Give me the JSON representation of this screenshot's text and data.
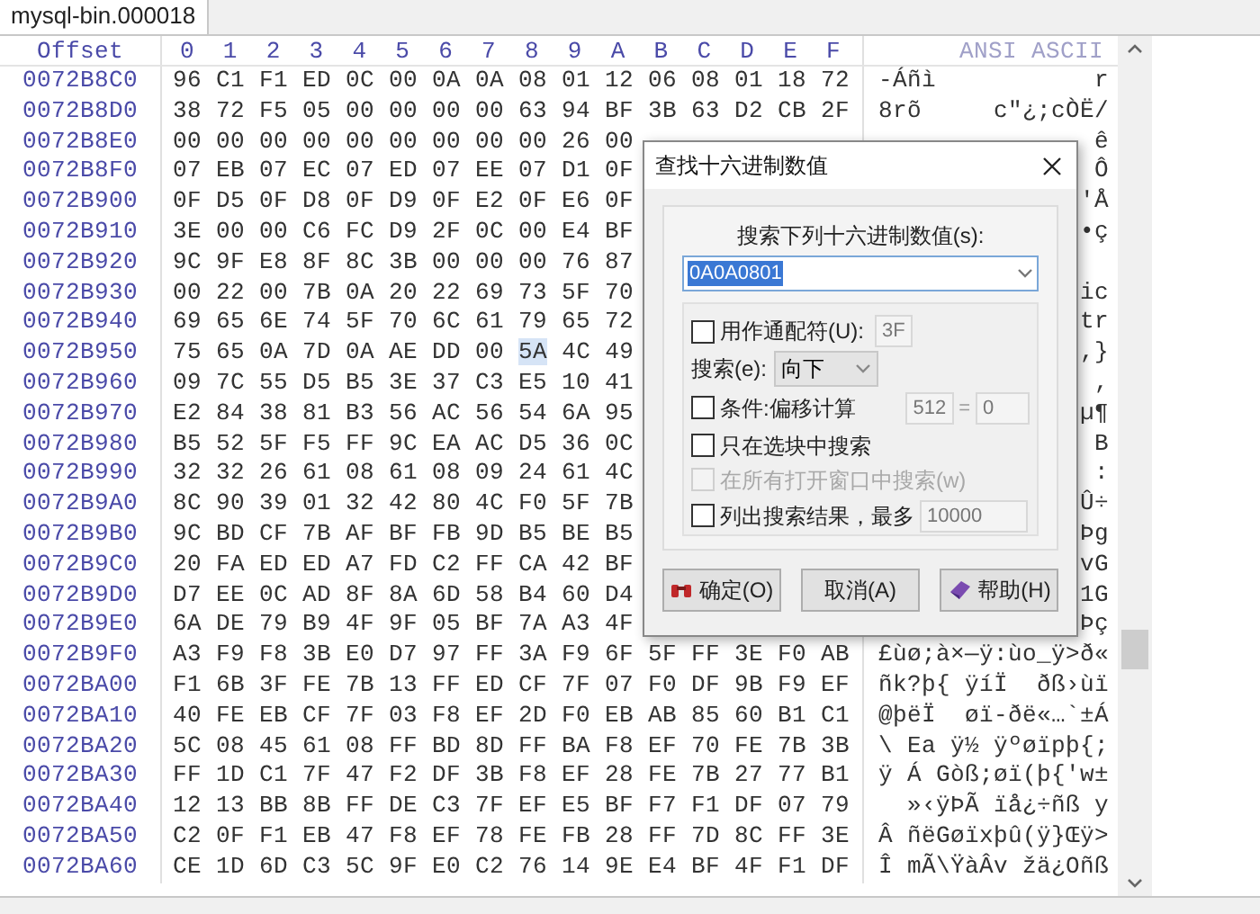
{
  "tab": {
    "label": "mysql-bin.000018",
    "selected": true
  },
  "hex_view": {
    "offset_header": "Offset",
    "column_headers": [
      "0",
      "1",
      "2",
      "3",
      "4",
      "5",
      "6",
      "7",
      "8",
      "9",
      "A",
      "B",
      "C",
      "D",
      "E",
      "F"
    ],
    "ascii_header": "ANSI ASCII",
    "rows": [
      {
        "kind": "full",
        "offset": "0072B8C0",
        "bytes": [
          {
            "text": "96 C1 F1 ED 0C 00 0A 0A 08 01 12 06 08 01 18 72",
            "selected": false
          }
        ],
        "ascii": "-Áñì           r"
      },
      {
        "kind": "full",
        "offset": "0072B8D0",
        "bytes": [
          {
            "text": "38 72 F5 05 00 00 00 00 63 94 BF 3B 63 D2 CB 2F",
            "selected": false
          }
        ],
        "ascii": "8rõ     c\"¿;cÒË/"
      },
      {
        "kind": "partial",
        "offset": "0072B8E0",
        "bytes": [
          {
            "text": "00 00 00 00 00 00 00 00 00 26 00",
            "selected": false
          }
        ],
        "ascii": "ê"
      },
      {
        "kind": "partial",
        "offset": "0072B8F0",
        "bytes": [
          {
            "text": "07 EB 07 EC 07 ED 07 EE 07 D1 0F",
            "selected": false
          }
        ],
        "ascii": "Ô"
      },
      {
        "kind": "partial",
        "offset": "0072B900",
        "bytes": [
          {
            "text": "0F D5 0F D8 0F D9 0F E2 0F E6 0F",
            "selected": false
          }
        ],
        "ascii": "'Å"
      },
      {
        "kind": "partial",
        "offset": "0072B910",
        "bytes": [
          {
            "text": "3E 00 00 C6 FC D9 2F 0C 00 E4 BF",
            "selected": false
          }
        ],
        "ascii": "•ç"
      },
      {
        "kind": "partial",
        "offset": "0072B920",
        "bytes": [
          {
            "text": "9C 9F E8 8F 8C 3B 00 00 00 76 87",
            "selected": false
          }
        ]
      },
      {
        "kind": "partial",
        "offset": "0072B930",
        "bytes": [
          {
            "text": "00 22 00 7B 0A 20 22 69 73 5F 70",
            "selected": false
          }
        ],
        "ascii": "ic"
      },
      {
        "kind": "partial",
        "offset": "0072B940",
        "bytes": [
          {
            "text": "69 65 6E 74 5F 70 6C 61 79 65 72",
            "selected": false
          }
        ],
        "ascii": "tr"
      },
      {
        "kind": "partial",
        "offset": "0072B950",
        "bytes": [
          {
            "text": "75 65 0A 7D 0A AE DD 00",
            "selected": false
          },
          {
            "text": "5A",
            "selected": true
          },
          {
            "text": "4C 49",
            "selected": false
          }
        ],
        "ascii": ",}"
      },
      {
        "kind": "partial",
        "offset": "0072B960",
        "bytes": [
          {
            "text": "09 7C 55 D5 B5 3E 37 C3 E5 10 41",
            "selected": false
          }
        ],
        "ascii": ","
      },
      {
        "kind": "partial",
        "offset": "0072B970",
        "bytes": [
          {
            "text": "E2 84 38 81 B3 56 AC 56 54 6A 95",
            "selected": false
          }
        ],
        "ascii": "µ¶"
      },
      {
        "kind": "partial",
        "offset": "0072B980",
        "bytes": [
          {
            "text": "B5 52 5F F5 FF 9C EA AC D5 36 0C",
            "selected": false
          }
        ],
        "ascii": "B"
      },
      {
        "kind": "partial",
        "offset": "0072B990",
        "bytes": [
          {
            "text": "32 32 26 61 08 61 08 09 24 61 4C",
            "selected": false
          }
        ],
        "ascii": ":"
      },
      {
        "kind": "partial",
        "offset": "0072B9A0",
        "bytes": [
          {
            "text": "8C 90 39 01 32 42 80 4C F0 5F 7B",
            "selected": false
          }
        ],
        "ascii": "Û÷"
      },
      {
        "kind": "partial",
        "offset": "0072B9B0",
        "bytes": [
          {
            "text": "9C BD CF 7B AF BF FB 9D B5 BE B5",
            "selected": false
          }
        ],
        "ascii": "Þg"
      },
      {
        "kind": "partial",
        "offset": "0072B9C0",
        "bytes": [
          {
            "text": "20 FA ED ED A7 FD C2 FF CA 42 BF",
            "selected": false
          }
        ],
        "ascii": "vG"
      },
      {
        "kind": "partial",
        "offset": "0072B9D0",
        "bytes": [
          {
            "text": "D7 EE 0C AD 8F 8A 6D 58 B4 60 D4",
            "selected": false
          }
        ],
        "ascii": "1G"
      },
      {
        "kind": "partial",
        "offset": "0072B9E0",
        "bytes": [
          {
            "text": "6A DE 79 B9 4F 9F 05 BF 7A A3 4F",
            "selected": false
          }
        ],
        "ascii": "Þç"
      },
      {
        "kind": "full",
        "offset": "0072B9F0",
        "bytes": [
          {
            "text": "A3 F9 F8 3B E0 D7 97 FF 3A F9 6F 5F FF 3E F0 AB",
            "selected": false
          }
        ],
        "ascii": "£ùø;à×—ÿ:ùo_ÿ>ð«"
      },
      {
        "kind": "full",
        "offset": "0072BA00",
        "bytes": [
          {
            "text": "F1 6B 3F FE 7B 13 FF ED CF 7F 07 F0 DF 9B F9 EF",
            "selected": false
          }
        ],
        "ascii": "ñk?þ{ ÿíÏ  ðß›ùï"
      },
      {
        "kind": "full",
        "offset": "0072BA10",
        "bytes": [
          {
            "text": "40 FE EB CF 7F 03 F8 EF 2D F0 EB AB 85 60 B1 C1",
            "selected": false
          }
        ],
        "ascii": "@þëÏ  øï-ðë«…`±Á"
      },
      {
        "kind": "full",
        "offset": "0072BA20",
        "bytes": [
          {
            "text": "5C 08 45 61 08 FF BD 8D FF BA F8 EF 70 FE 7B 3B",
            "selected": false
          }
        ],
        "ascii": "\\ Ea ÿ½ ÿºøïpþ{;"
      },
      {
        "kind": "full",
        "offset": "0072BA30",
        "bytes": [
          {
            "text": "FF 1D C1 7F 47 F2 DF 3B F8 EF 28 FE 7B 27 77 B1",
            "selected": false
          }
        ],
        "ascii": "ÿ Á Gòß;øï(þ{'w±"
      },
      {
        "kind": "full",
        "offset": "0072BA40",
        "bytes": [
          {
            "text": "12 13 BB 8B FF DE C3 7F EF E5 BF F7 F1 DF 07 79",
            "selected": false
          }
        ],
        "ascii": "  »‹ÿÞÃ ïå¿÷ñß y"
      },
      {
        "kind": "full",
        "offset": "0072BA50",
        "bytes": [
          {
            "text": "C2 0F F1 EB 47 F8 EF 78 FE FB 28 FF 7D 8C FF 3E",
            "selected": false
          }
        ],
        "ascii": "Â ñëGøïxþû(ÿ}Œÿ>"
      },
      {
        "kind": "full",
        "offset": "0072BA60",
        "bytes": [
          {
            "text": "CE 1D 6D C3 5C 9F E0 C2 76 14 9E E4 BF 4F F1 DF",
            "selected": false
          }
        ],
        "ascii": "Î mÃ\\ŸàÂv žä¿Oñß"
      }
    ]
  },
  "dialog": {
    "title": "查找十六进制数值",
    "prompt": "搜索下列十六进制数值(s):",
    "search_value": "0A0A0801",
    "wildcard": {
      "label": "用作通配符(U):",
      "checked": false,
      "disabled": false,
      "value": "3F"
    },
    "direction": {
      "label": "搜索(e):",
      "value": "向下"
    },
    "offset_condition": {
      "label": "条件:偏移计算",
      "checked": false,
      "disabled": false,
      "value": "512",
      "equals": "=",
      "result": "0"
    },
    "block_only": {
      "label": "只在选块中搜索",
      "checked": false,
      "disabled": false
    },
    "all_windows": {
      "label": "在所有打开窗口中搜索(w)",
      "checked": false,
      "disabled": true
    },
    "list_results": {
      "label": "列出搜索结果，最多",
      "checked": false,
      "disabled": false,
      "value": "10000"
    },
    "buttons": [
      {
        "label": "确定(O)",
        "kind": "ok"
      },
      {
        "label": "取消(A)",
        "kind": "plain"
      },
      {
        "label": "帮助(H)",
        "kind": "help"
      }
    ]
  }
}
